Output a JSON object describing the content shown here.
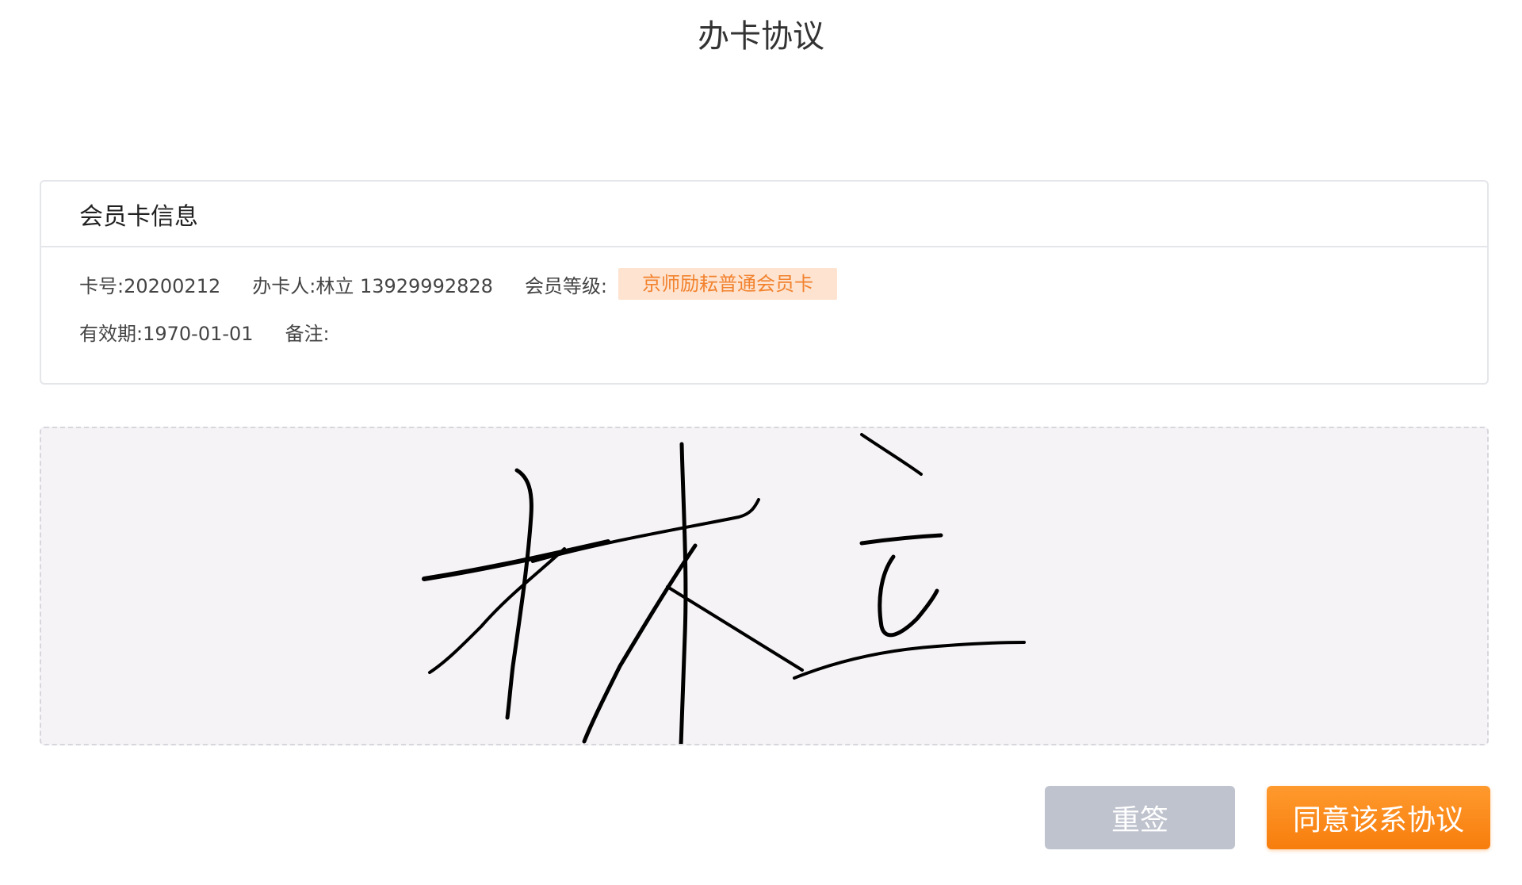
{
  "page": {
    "title": "办卡协议"
  },
  "card_info": {
    "header": "会员卡信息",
    "card_no": "卡号:20200212",
    "applicant": "办卡人:林立 13929992828",
    "level_label": "会员等级:",
    "level_value": "京师励耘普通会员卡",
    "validity": "有效期:1970-01-01",
    "remark": "备注:"
  },
  "signature": {
    "signer_name": "林立"
  },
  "actions": {
    "reset_label": "重签",
    "agree_label": "同意该系协议"
  },
  "colors": {
    "accent": "#f77d0c",
    "badge_bg": "#fde3d0",
    "badge_text": "#f2822e",
    "reset_button": "#bfc3ce",
    "signature_bg": "#f6f3f6"
  }
}
